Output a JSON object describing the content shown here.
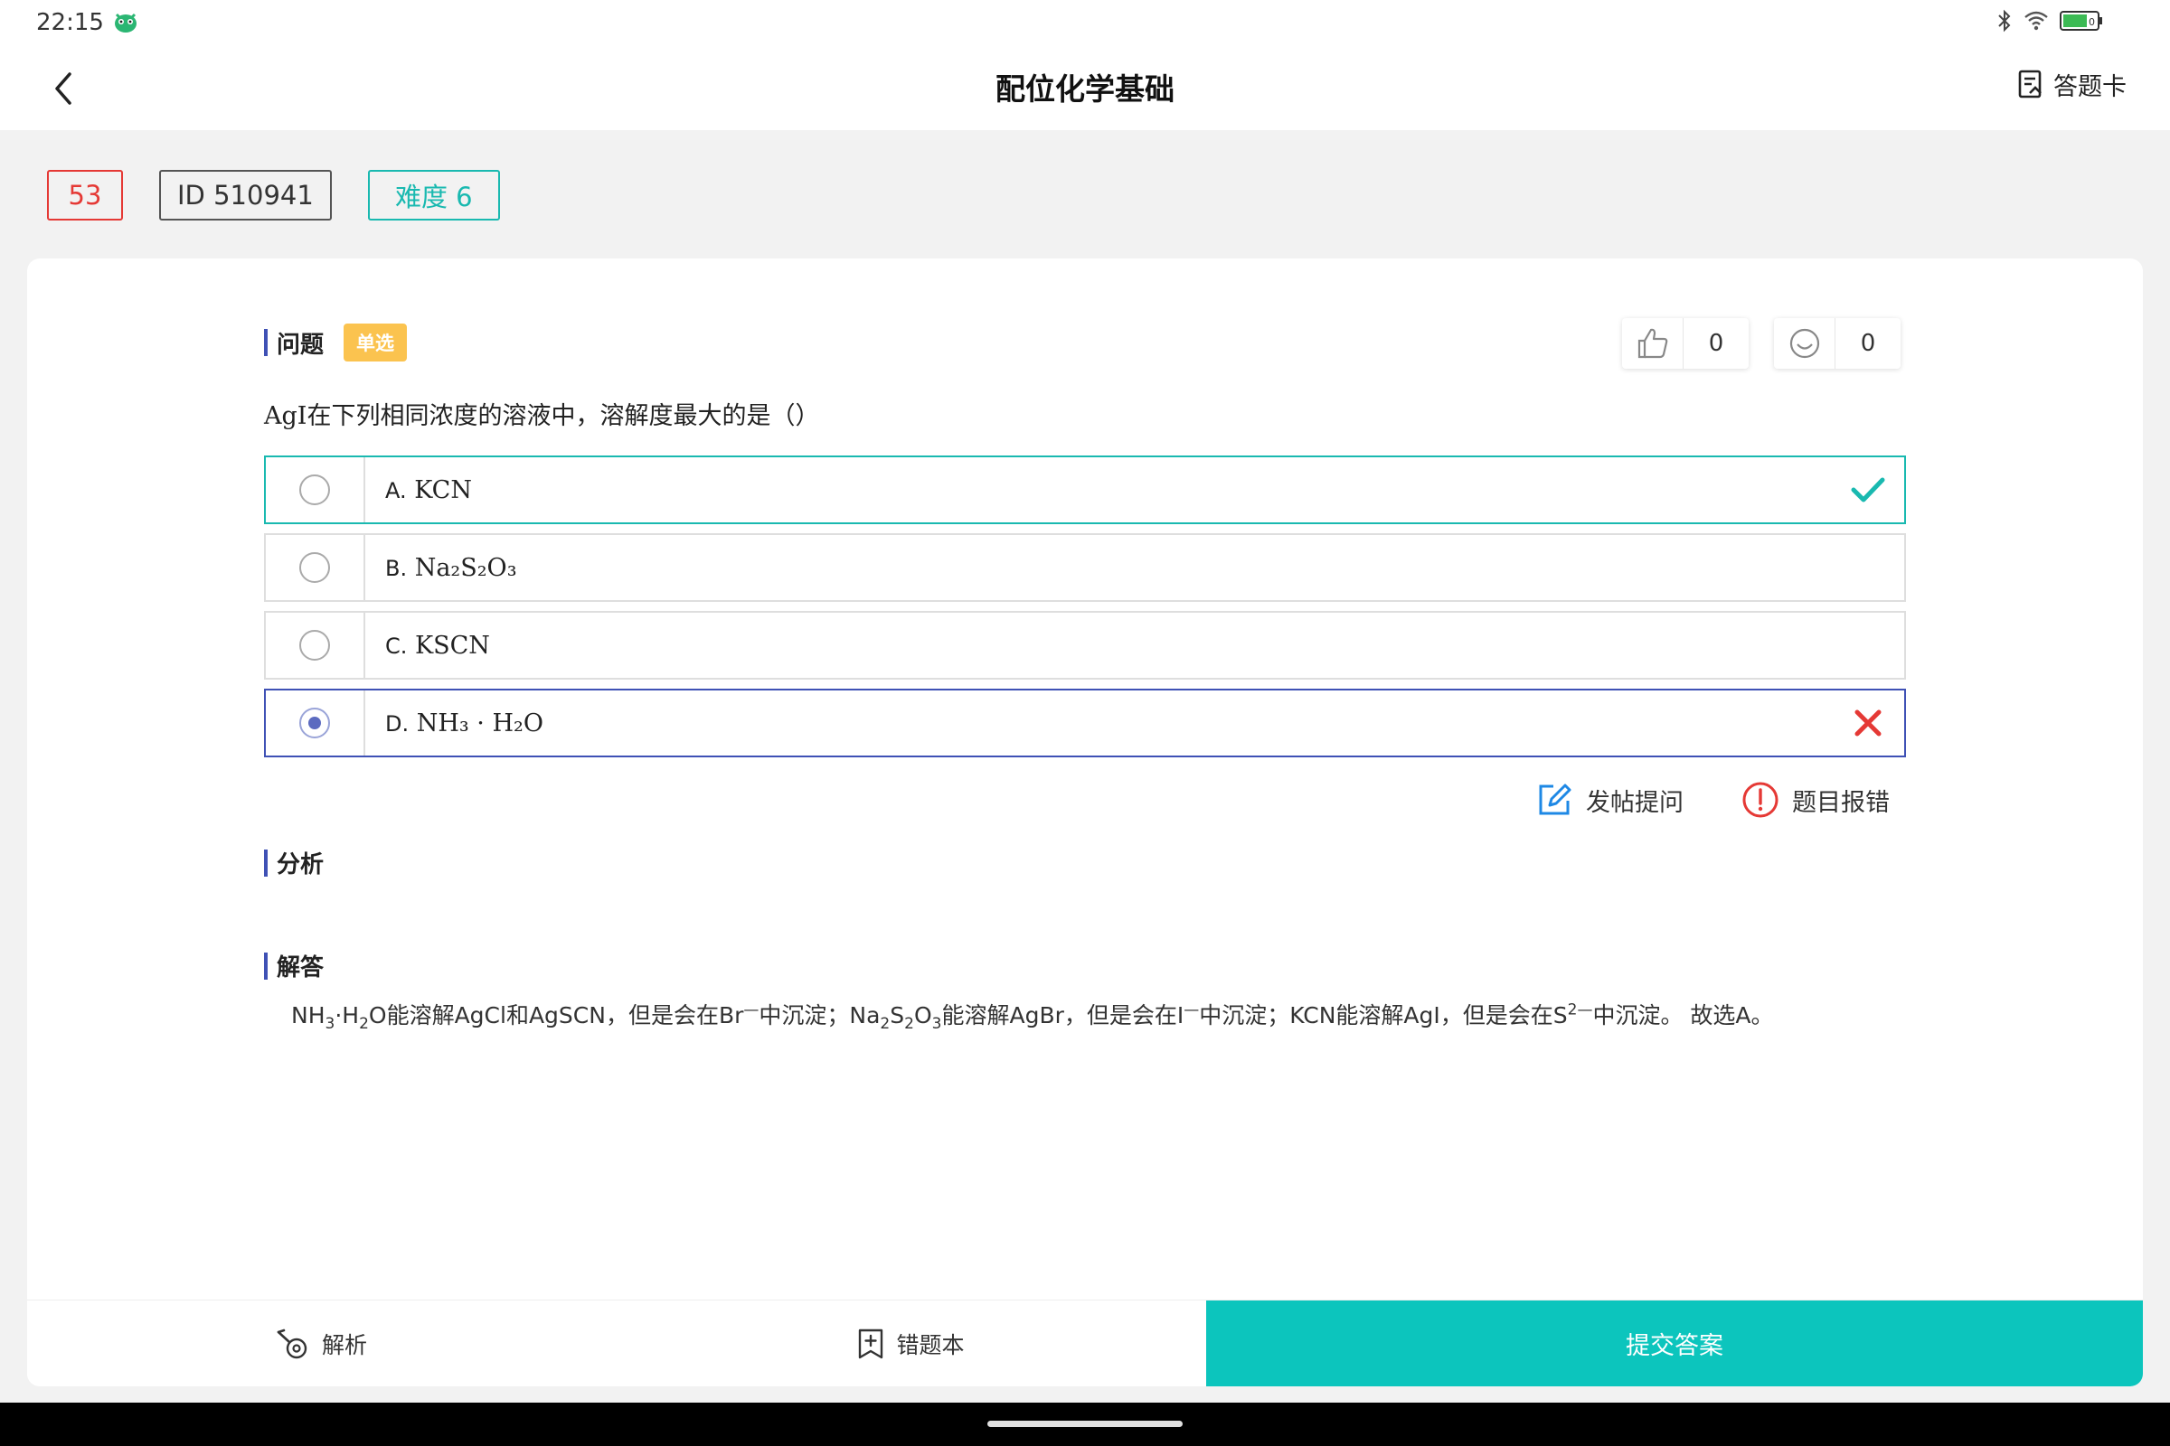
{
  "status_bar": {
    "time": "22:15",
    "battery_level": "0",
    "icons": [
      "app-mascot-icon",
      "bluetooth-icon",
      "wifi-icon",
      "battery-icon"
    ]
  },
  "header": {
    "title": "配位化学基础",
    "answer_card_label": "答题卡"
  },
  "meta": {
    "number": "53",
    "id": "ID 510941",
    "difficulty": "难度 6"
  },
  "question": {
    "section_label": "问题",
    "type_badge": "单选",
    "likes": "0",
    "reactions": "0",
    "stem": "AgI在下列相同浓度的溶液中，溶解度最大的是（）",
    "options": [
      {
        "letter": "A.",
        "formula": "KCN",
        "state": "correct"
      },
      {
        "letter": "B.",
        "formula": "Na₂S₂O₃",
        "state": "none"
      },
      {
        "letter": "C.",
        "formula": "KSCN",
        "state": "none"
      },
      {
        "letter": "D.",
        "formula": "NH₃ · H₂O",
        "state": "selected-wrong"
      }
    ]
  },
  "actions": {
    "post_question": "发帖提问",
    "report": "题目报错"
  },
  "analysis": {
    "section_label": "分析"
  },
  "solution": {
    "section_label": "解答",
    "text": {
      "p1": "NH",
      "s1": "3",
      "p2": "·H",
      "s2": "2",
      "p3": "O能溶解AgCl和AgSCN，但是会在Br",
      "sup1": "—",
      "p4": "中沉淀；Na",
      "s3": "2",
      "p5": "S",
      "s4": "2",
      "p6": "O",
      "s5": "3",
      "p7": "能溶解AgBr，但是会在I",
      "sup2": "—",
      "p8": "中沉淀；KCN能溶解AgI，但是会在S",
      "sup3": "2—",
      "p9": "中沉淀。 故选A。"
    }
  },
  "bottom_bar": {
    "analysis_label": "解析",
    "wrong_book_label": "错题本",
    "submit_label": "提交答案"
  },
  "colors": {
    "accent_teal": "#0cc5bd",
    "correct": "#19b9b0",
    "wrong": "#e53935",
    "selected_border": "#3f51b5",
    "badge_yellow": "#fbc34f"
  }
}
